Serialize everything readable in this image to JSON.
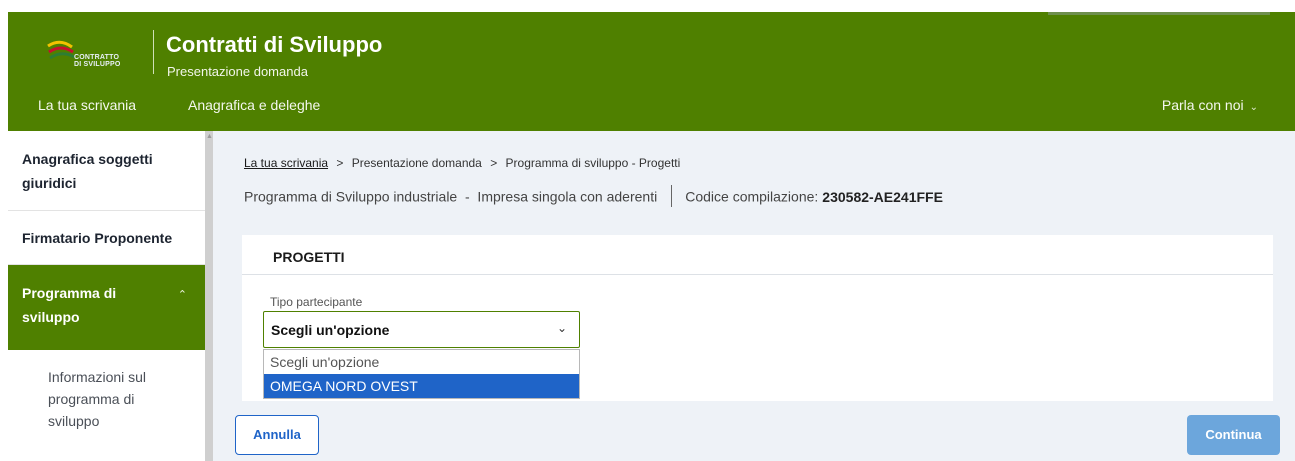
{
  "header": {
    "logo_text_line1": "CONTRATTO",
    "logo_text_line2": "DI SVILUPPO",
    "title": "Contratti di Sviluppo",
    "subtitle": "Presentazione domanda",
    "nav": [
      "La tua scrivania",
      "Anagrafica e deleghe"
    ],
    "help_label": "Parla con noi"
  },
  "sidebar": {
    "items": [
      {
        "label": "Anagrafica soggetti giuridici"
      },
      {
        "label": "Firmatario Proponente"
      },
      {
        "label": "Programma di sviluppo",
        "expanded": true
      }
    ],
    "subitems": [
      "Informazioni sul programma di sviluppo"
    ]
  },
  "breadcrumb": {
    "link": "La tua scrivania",
    "items": [
      "Presentazione domanda",
      "Programma di sviluppo - Progetti"
    ],
    "separator": ">"
  },
  "program": {
    "description": "Programma di Sviluppo industriale  -  Impresa singola con aderenti",
    "code_label": "Codice compilazione:",
    "code_value": "230582-AE241FFE"
  },
  "card": {
    "title": "PROGETTI",
    "field_label": "Tipo partecipante",
    "select_value": "Scegli un'opzione",
    "options": [
      "Scegli un'opzione",
      "OMEGA NORD OVEST"
    ],
    "highlighted_option": "OMEGA NORD OVEST"
  },
  "actions": {
    "cancel": "Annulla",
    "continue": "Continua"
  },
  "colors": {
    "brand_green": "#4f8000",
    "page_bg": "#eef2f7",
    "accent_blue": "#1f64c8",
    "continue_disabled": "#6ca6dc"
  }
}
